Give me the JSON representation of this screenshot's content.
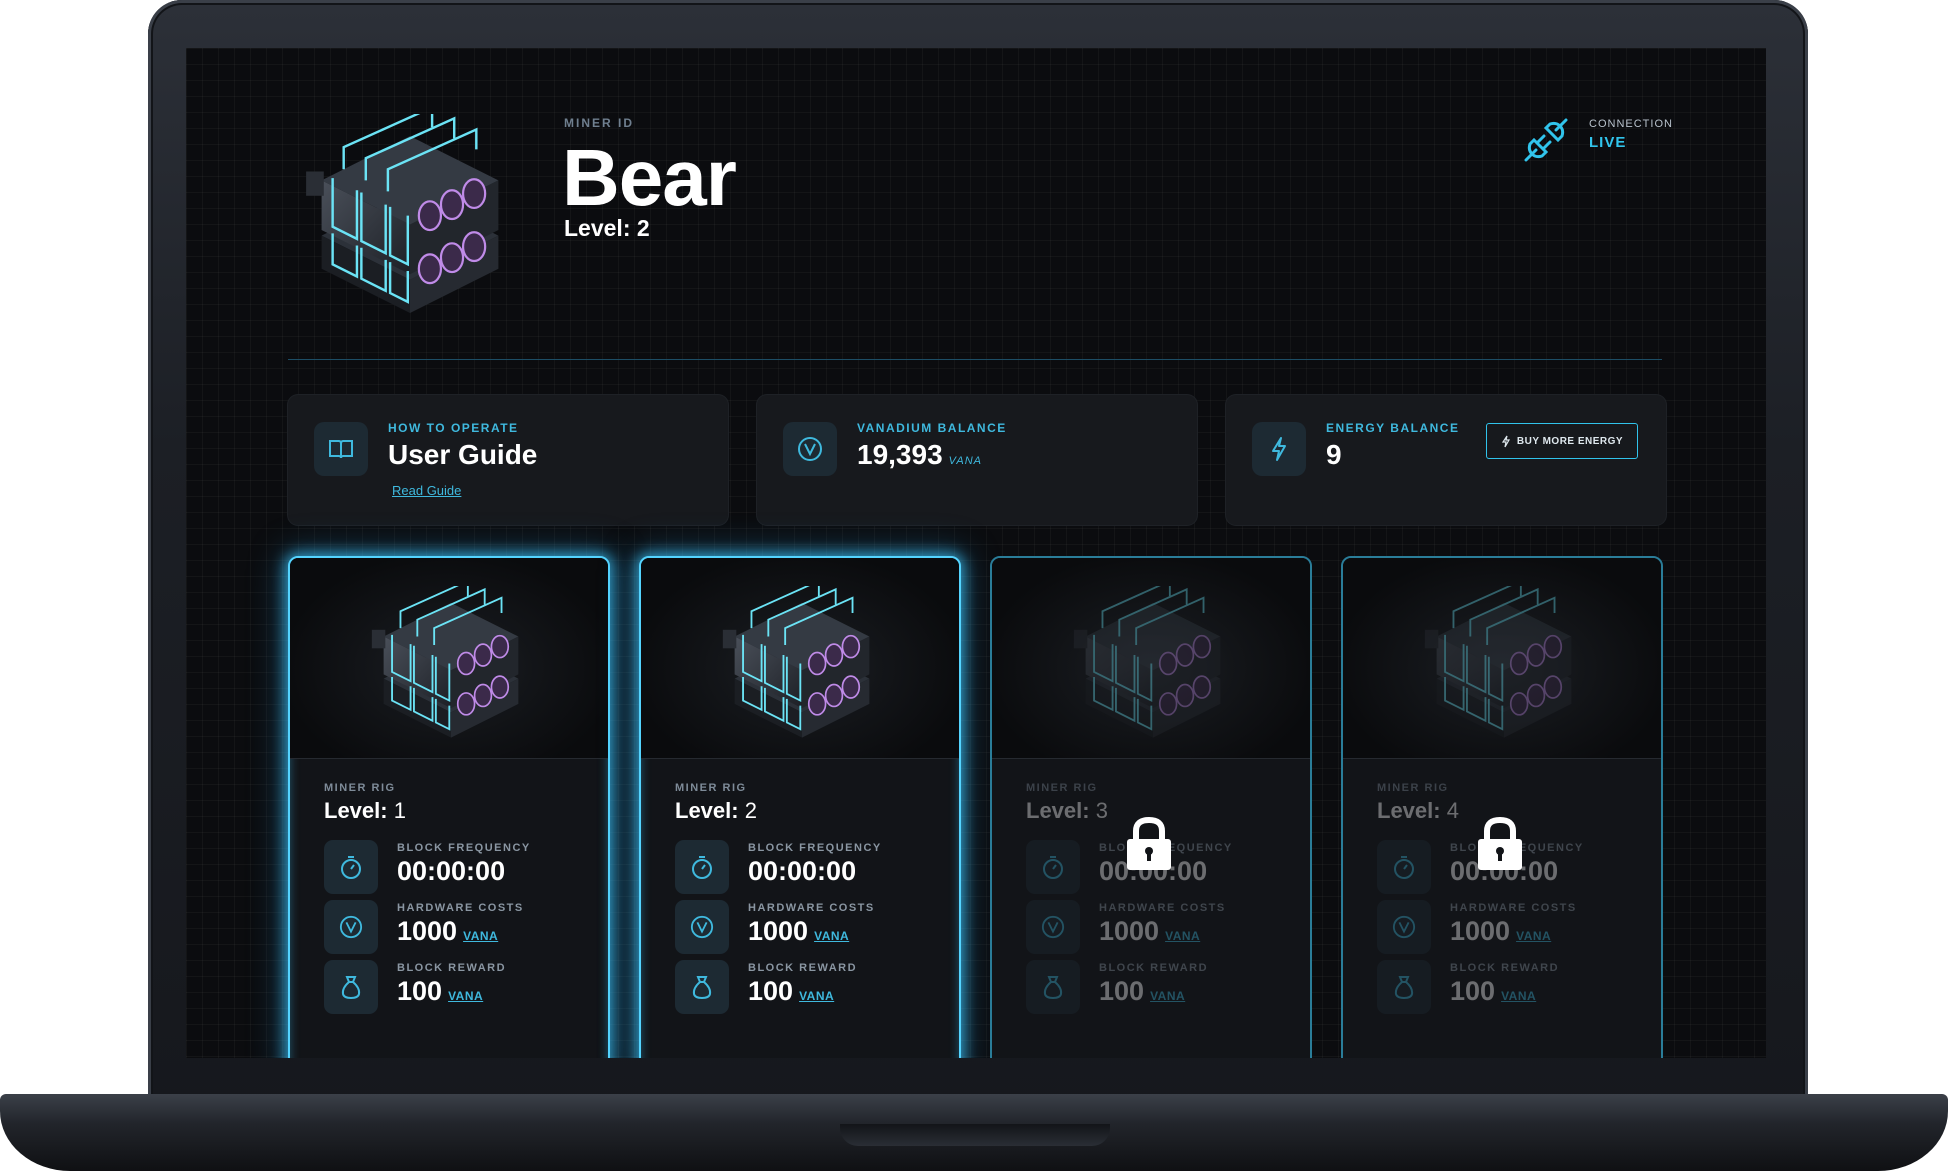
{
  "header": {
    "miner_id_label": "MINER ID",
    "miner_name": "Bear",
    "level": "Level: 2"
  },
  "connection": {
    "label": "CONNECTION",
    "status": "LIVE",
    "icon": "plug-icon"
  },
  "info_cards": [
    {
      "label": "HOW TO OPERATE",
      "value": "User Guide",
      "link": "Read Guide",
      "icon": "book-icon"
    },
    {
      "label": "VANADIUM BALANCE",
      "value": "19,393",
      "unit": "VANA",
      "icon": "vanadium-icon"
    },
    {
      "label": "ENERGY BALANCE",
      "value": "9",
      "button": "BUY MORE ENERGY",
      "icon": "lightning-icon"
    }
  ],
  "rig_cards": [
    {
      "kind": "MINER RIG",
      "level_label": "Level:",
      "level": "1",
      "locked": false,
      "block_frequency_label": "BLOCK FREQUENCY",
      "block_frequency": "00:00:00",
      "hardware_costs_label": "HARDWARE COSTS",
      "hardware_costs": "1000",
      "hardware_unit": "VANA",
      "block_reward_label": "BLOCK REWARD",
      "block_reward": "100",
      "reward_unit": "VANA"
    },
    {
      "kind": "MINER RIG",
      "level_label": "Level:",
      "level": "2",
      "locked": false,
      "block_frequency_label": "BLOCK FREQUENCY",
      "block_frequency": "00:00:00",
      "hardware_costs_label": "HARDWARE COSTS",
      "hardware_costs": "1000",
      "hardware_unit": "VANA",
      "block_reward_label": "BLOCK REWARD",
      "block_reward": "100",
      "reward_unit": "VANA"
    },
    {
      "kind": "MINER RIG",
      "level_label": "Level:",
      "level": "3",
      "locked": true,
      "block_frequency_label": "BLOCK FREQUENCY",
      "block_frequency": "00:00:00",
      "hardware_costs_label": "HARDWARE COSTS",
      "hardware_costs": "1000",
      "hardware_unit": "VANA",
      "block_reward_label": "BLOCK REWARD",
      "block_reward": "100",
      "reward_unit": "VANA"
    },
    {
      "kind": "MINER RIG",
      "level_label": "Level:",
      "level": "4",
      "locked": true,
      "block_frequency_label": "BLOCK FREQUENCY",
      "block_frequency": "00:00:00",
      "hardware_costs_label": "HARDWARE COSTS",
      "hardware_costs": "1000",
      "hardware_unit": "VANA",
      "block_reward_label": "BLOCK REWARD",
      "block_reward": "100",
      "reward_unit": "VANA"
    }
  ],
  "colors": {
    "accent": "#31c4ec",
    "background": "#0b0c0f",
    "card": "#17191d"
  }
}
